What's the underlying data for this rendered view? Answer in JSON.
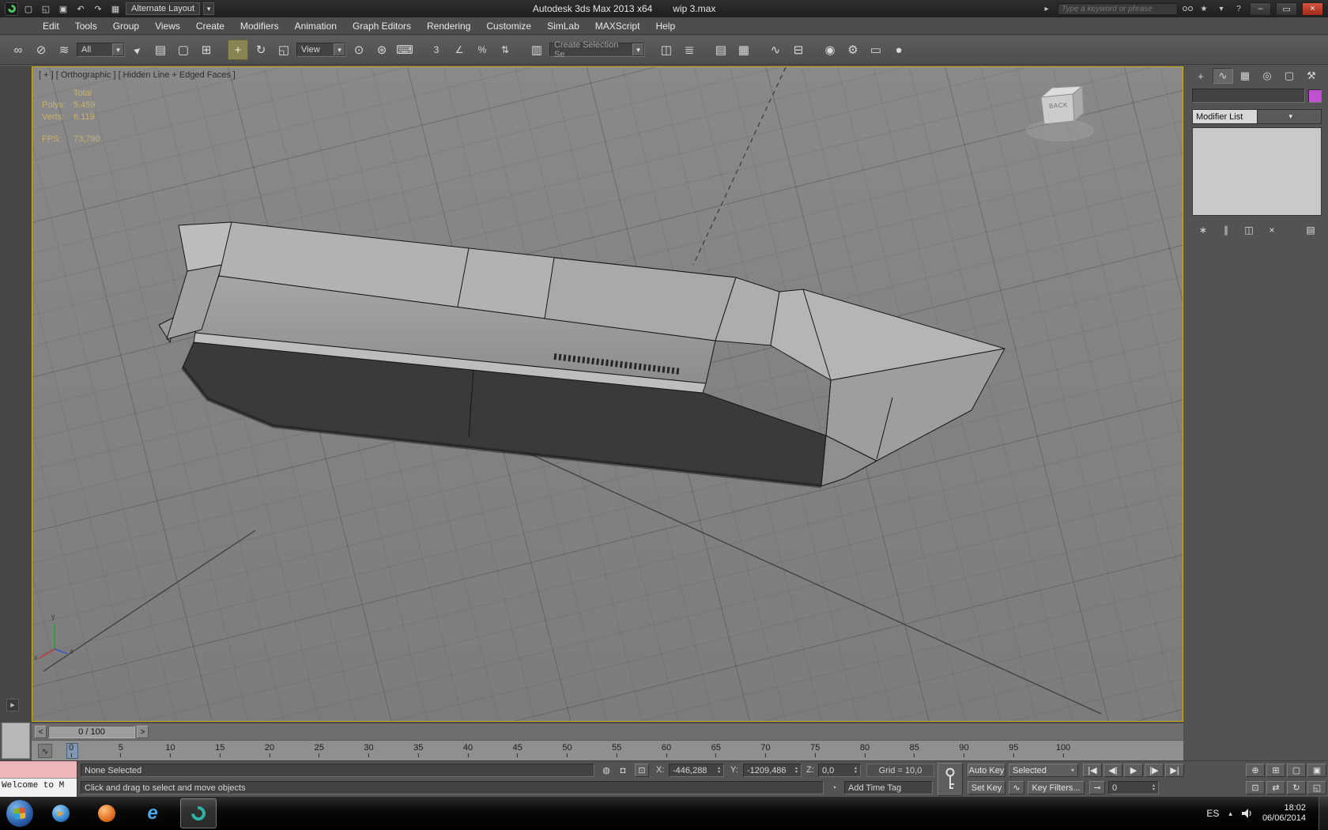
{
  "titlebar": {
    "layout_dropdown": "Alternate Layout",
    "app_title": "Autodesk 3ds Max 2013 x64",
    "file_name": "wip 3.max",
    "search_placeholder": "Type a keyword or phrase"
  },
  "menubar": {
    "items": [
      "Edit",
      "Tools",
      "Group",
      "Views",
      "Create",
      "Modifiers",
      "Animation",
      "Graph Editors",
      "Rendering",
      "Customize",
      "SimLab",
      "MAXScript",
      "Help"
    ]
  },
  "toolbar": {
    "filter_value": "All",
    "coord_system": "View",
    "selection_set_placeholder": "Create Selection Se",
    "snap_label": "3"
  },
  "viewport": {
    "label": "[ + ] [ Orthographic ] [ Hidden Line + Edged Faces ]",
    "stats": {
      "total_label": "Total",
      "polys_label": "Polys:",
      "polys_value": "5.459",
      "verts_label": "Verts:",
      "verts_value": "6.119",
      "fps_label": "FPS:",
      "fps_value": "73,790"
    },
    "viewcube_face": "BACK",
    "axis_x": "x",
    "axis_y": "y",
    "axis_z": "z"
  },
  "command_panel": {
    "modifier_list": "Modifier List"
  },
  "timeline": {
    "position_display": "0 / 100",
    "ticks": [
      "0",
      "5",
      "10",
      "15",
      "20",
      "25",
      "30",
      "35",
      "40",
      "45",
      "50",
      "55",
      "60",
      "65",
      "70",
      "75",
      "80",
      "85",
      "90",
      "95",
      "100"
    ]
  },
  "status_bar": {
    "selection_status": "None Selected",
    "prompt": "Click and drag to select and move objects",
    "x_label": "X:",
    "x_value": "-446,288",
    "y_label": "Y:",
    "y_value": "-1209,486",
    "z_label": "Z:",
    "z_value": "0,0",
    "grid_label": "Grid = 10,0",
    "add_time_tag": "Add Time Tag",
    "auto_key": "Auto Key",
    "set_key": "Set Key",
    "key_mode_dropdown": "Selected",
    "key_filters": "Key Filters...",
    "frame_value": "0"
  },
  "mini_listener": {
    "text": "Welcome to M"
  },
  "taskbar": {
    "language": "ES",
    "time": "18:02",
    "date": "06/06/2014"
  },
  "colors": {
    "active_viewport_border": "#d2b016",
    "object_color_swatch": "#c24fd4",
    "stats_text": "#cbb269",
    "close_button": "#b03020"
  },
  "icons": {
    "new": "▢",
    "open": "◱",
    "save": "▣",
    "undo": "↶",
    "redo": "↷",
    "workspace": "▦",
    "dropdown_arrow": "▾",
    "titlebar_expand": "▸",
    "favorites": "★",
    "updates": "▾",
    "help": "?",
    "minimize": "–",
    "maximize": "▭",
    "close": "×",
    "link": "∞",
    "unlink": "⊘",
    "bind": "≋",
    "select": "►",
    "select_by_name": "▤",
    "region": "▢",
    "window_crossing": "⊞",
    "move": "+",
    "rotate": "↻",
    "scale": "◱",
    "pivot": "⊙",
    "manipulate": "⊛",
    "keyboard": "⌨",
    "snap_angle": "∠",
    "snap_percent": "%",
    "snap_spinner": "⇅",
    "named_sets": "▥",
    "mirror": "◫",
    "align": "≣",
    "layers": "▤",
    "ribbon": "▦",
    "curve_editor": "∿",
    "schematic": "⊟",
    "material": "◉",
    "render_setup": "⚙",
    "rendered_frame": "▭",
    "render": "●",
    "tab_create": "+",
    "tab_modify": "∿",
    "tab_hierarchy": "▦",
    "tab_motion": "◎",
    "tab_display": "▢",
    "tab_utilities": "⚒",
    "pin_stack": "∗",
    "show_end_result": "∥",
    "make_unique": "◫",
    "remove_modifier": "×",
    "configure_sets": "▤",
    "isolate": "◍",
    "lock": "◘",
    "abs_offset": "⊡",
    "time_tag": "◔",
    "key_mode": "⊸",
    "play_start": "|◀",
    "play_prev": "◀|",
    "play": "▶",
    "play_next": "|▶",
    "play_end": "▶|",
    "spinner_up": "▴",
    "spinner_down": "▾",
    "nav_zoom": "⊕",
    "nav_zoom_all": "⊞",
    "nav_extents": "▢",
    "nav_extents_all": "▣",
    "nav_region": "⊡",
    "nav_pan": "⇄",
    "nav_arc": "↻",
    "nav_maximize": "◱",
    "track_left": "<",
    "track_right": ">",
    "curve_mini": "∿",
    "left_expand": "▶",
    "tray_hidden": "▴"
  }
}
